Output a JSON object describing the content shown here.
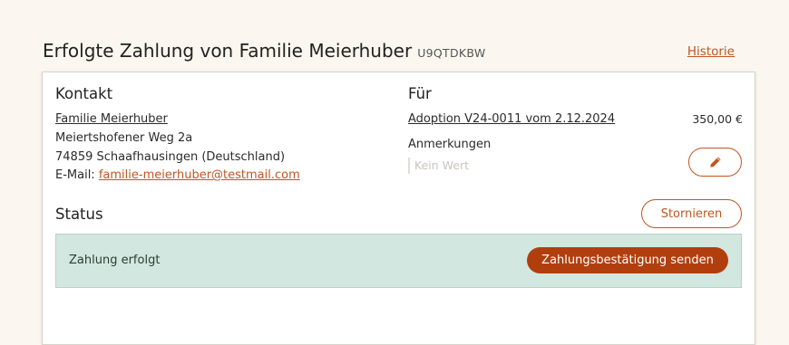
{
  "header": {
    "title": "Erfolgte Zahlung von Familie Meierhuber",
    "payment_id": "U9QTDKBW",
    "history_link": "Historie"
  },
  "contact": {
    "heading": "Kontakt",
    "name": "Familie Meierhuber",
    "street": "Meiertshofener Weg 2a",
    "city": "74859 Schaafhausingen (Deutschland)",
    "email_label": "E-Mail:",
    "email": "familie-meierhuber@testmail.com"
  },
  "for": {
    "heading": "Für",
    "adoption_link": "Adoption V24-0011 vom 2.12.2024",
    "amount": "350,00 €",
    "notes_label": "Anmerkungen",
    "notes_value": "Kein Wert",
    "edit_icon": "pencil-icon"
  },
  "status": {
    "heading": "Status",
    "cancel_label": "Stornieren",
    "state_text": "Zahlung erfolgt",
    "send_confirmation_label": "Zahlungsbestätigung senden"
  },
  "colors": {
    "accent": "#c05621",
    "primary_button": "#b13f0e",
    "status_background": "#d2e7df",
    "page_background": "#fbf6ef"
  }
}
